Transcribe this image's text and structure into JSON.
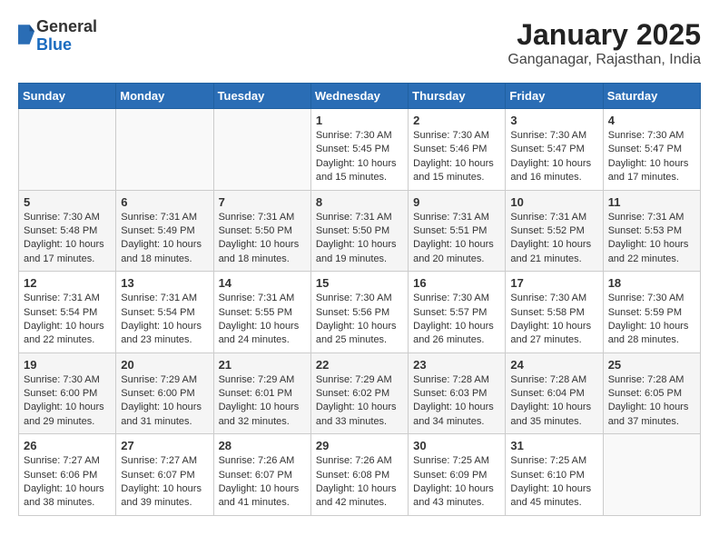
{
  "header": {
    "logo_general": "General",
    "logo_blue": "Blue",
    "title": "January 2025",
    "subtitle": "Ganganagar, Rajasthan, India"
  },
  "calendar": {
    "weekdays": [
      "Sunday",
      "Monday",
      "Tuesday",
      "Wednesday",
      "Thursday",
      "Friday",
      "Saturday"
    ],
    "weeks": [
      [
        {
          "day": "",
          "info": ""
        },
        {
          "day": "",
          "info": ""
        },
        {
          "day": "",
          "info": ""
        },
        {
          "day": "1",
          "info": "Sunrise: 7:30 AM\nSunset: 5:45 PM\nDaylight: 10 hours\nand 15 minutes."
        },
        {
          "day": "2",
          "info": "Sunrise: 7:30 AM\nSunset: 5:46 PM\nDaylight: 10 hours\nand 15 minutes."
        },
        {
          "day": "3",
          "info": "Sunrise: 7:30 AM\nSunset: 5:47 PM\nDaylight: 10 hours\nand 16 minutes."
        },
        {
          "day": "4",
          "info": "Sunrise: 7:30 AM\nSunset: 5:47 PM\nDaylight: 10 hours\nand 17 minutes."
        }
      ],
      [
        {
          "day": "5",
          "info": "Sunrise: 7:30 AM\nSunset: 5:48 PM\nDaylight: 10 hours\nand 17 minutes."
        },
        {
          "day": "6",
          "info": "Sunrise: 7:31 AM\nSunset: 5:49 PM\nDaylight: 10 hours\nand 18 minutes."
        },
        {
          "day": "7",
          "info": "Sunrise: 7:31 AM\nSunset: 5:50 PM\nDaylight: 10 hours\nand 18 minutes."
        },
        {
          "day": "8",
          "info": "Sunrise: 7:31 AM\nSunset: 5:50 PM\nDaylight: 10 hours\nand 19 minutes."
        },
        {
          "day": "9",
          "info": "Sunrise: 7:31 AM\nSunset: 5:51 PM\nDaylight: 10 hours\nand 20 minutes."
        },
        {
          "day": "10",
          "info": "Sunrise: 7:31 AM\nSunset: 5:52 PM\nDaylight: 10 hours\nand 21 minutes."
        },
        {
          "day": "11",
          "info": "Sunrise: 7:31 AM\nSunset: 5:53 PM\nDaylight: 10 hours\nand 22 minutes."
        }
      ],
      [
        {
          "day": "12",
          "info": "Sunrise: 7:31 AM\nSunset: 5:54 PM\nDaylight: 10 hours\nand 22 minutes."
        },
        {
          "day": "13",
          "info": "Sunrise: 7:31 AM\nSunset: 5:54 PM\nDaylight: 10 hours\nand 23 minutes."
        },
        {
          "day": "14",
          "info": "Sunrise: 7:31 AM\nSunset: 5:55 PM\nDaylight: 10 hours\nand 24 minutes."
        },
        {
          "day": "15",
          "info": "Sunrise: 7:30 AM\nSunset: 5:56 PM\nDaylight: 10 hours\nand 25 minutes."
        },
        {
          "day": "16",
          "info": "Sunrise: 7:30 AM\nSunset: 5:57 PM\nDaylight: 10 hours\nand 26 minutes."
        },
        {
          "day": "17",
          "info": "Sunrise: 7:30 AM\nSunset: 5:58 PM\nDaylight: 10 hours\nand 27 minutes."
        },
        {
          "day": "18",
          "info": "Sunrise: 7:30 AM\nSunset: 5:59 PM\nDaylight: 10 hours\nand 28 minutes."
        }
      ],
      [
        {
          "day": "19",
          "info": "Sunrise: 7:30 AM\nSunset: 6:00 PM\nDaylight: 10 hours\nand 29 minutes."
        },
        {
          "day": "20",
          "info": "Sunrise: 7:29 AM\nSunset: 6:00 PM\nDaylight: 10 hours\nand 31 minutes."
        },
        {
          "day": "21",
          "info": "Sunrise: 7:29 AM\nSunset: 6:01 PM\nDaylight: 10 hours\nand 32 minutes."
        },
        {
          "day": "22",
          "info": "Sunrise: 7:29 AM\nSunset: 6:02 PM\nDaylight: 10 hours\nand 33 minutes."
        },
        {
          "day": "23",
          "info": "Sunrise: 7:28 AM\nSunset: 6:03 PM\nDaylight: 10 hours\nand 34 minutes."
        },
        {
          "day": "24",
          "info": "Sunrise: 7:28 AM\nSunset: 6:04 PM\nDaylight: 10 hours\nand 35 minutes."
        },
        {
          "day": "25",
          "info": "Sunrise: 7:28 AM\nSunset: 6:05 PM\nDaylight: 10 hours\nand 37 minutes."
        }
      ],
      [
        {
          "day": "26",
          "info": "Sunrise: 7:27 AM\nSunset: 6:06 PM\nDaylight: 10 hours\nand 38 minutes."
        },
        {
          "day": "27",
          "info": "Sunrise: 7:27 AM\nSunset: 6:07 PM\nDaylight: 10 hours\nand 39 minutes."
        },
        {
          "day": "28",
          "info": "Sunrise: 7:26 AM\nSunset: 6:07 PM\nDaylight: 10 hours\nand 41 minutes."
        },
        {
          "day": "29",
          "info": "Sunrise: 7:26 AM\nSunset: 6:08 PM\nDaylight: 10 hours\nand 42 minutes."
        },
        {
          "day": "30",
          "info": "Sunrise: 7:25 AM\nSunset: 6:09 PM\nDaylight: 10 hours\nand 43 minutes."
        },
        {
          "day": "31",
          "info": "Sunrise: 7:25 AM\nSunset: 6:10 PM\nDaylight: 10 hours\nand 45 minutes."
        },
        {
          "day": "",
          "info": ""
        }
      ]
    ]
  }
}
